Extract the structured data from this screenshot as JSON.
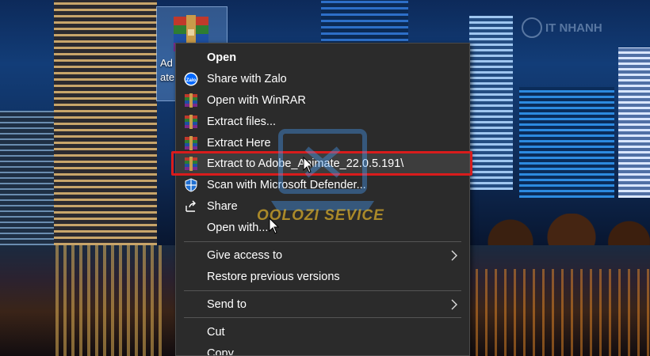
{
  "desktop": {
    "icon_label_line1": "Ad",
    "icon_label_line2": "ate"
  },
  "watermark": {
    "brand": "IT NHANH",
    "overlay_text": "OOLOZI SEVICE"
  },
  "menu": {
    "items": [
      {
        "label": "Open",
        "icon": "none",
        "bold": true
      },
      {
        "label": "Share with Zalo",
        "icon": "zalo-icon"
      },
      {
        "label": "Open with WinRAR",
        "icon": "winrar-icon"
      },
      {
        "label": "Extract files...",
        "icon": "winrar-icon"
      },
      {
        "label": "Extract Here",
        "icon": "winrar-icon"
      },
      {
        "label": "Extract to Adobe_Animate_22.0.5.191\\",
        "icon": "winrar-icon",
        "highlighted": true
      },
      {
        "label": "Scan with Microsoft Defender...",
        "icon": "defender-shield-icon"
      },
      {
        "label": "Share",
        "icon": "share-icon"
      },
      {
        "label": "Open with...",
        "icon": "none"
      },
      {
        "label": "Give access to",
        "icon": "none",
        "submenu": true
      },
      {
        "label": "Restore previous versions",
        "icon": "none"
      },
      {
        "label": "Send to",
        "icon": "none",
        "submenu": true
      },
      {
        "label": "Cut",
        "icon": "none"
      },
      {
        "label": "Copy",
        "icon": "none"
      }
    ]
  },
  "colors": {
    "menu_bg": "#2b2b2b",
    "highlight_border": "#d91c1c",
    "text": "#ffffff"
  }
}
